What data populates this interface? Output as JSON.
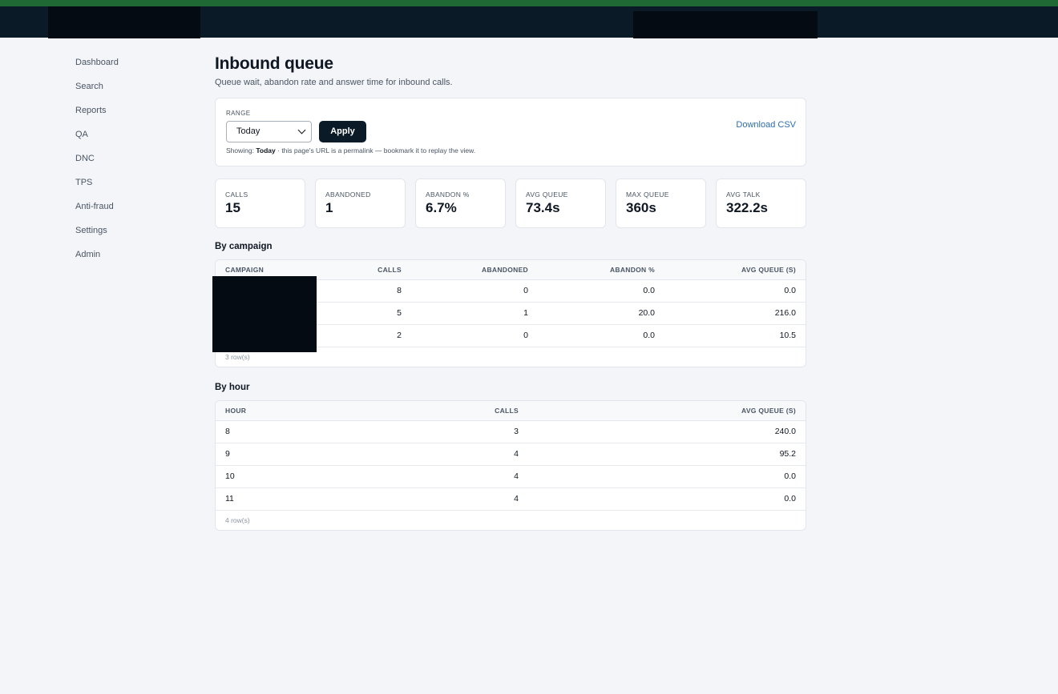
{
  "sidebar": {
    "items": [
      {
        "label": "Dashboard"
      },
      {
        "label": "Search"
      },
      {
        "label": "Reports"
      },
      {
        "label": "QA"
      },
      {
        "label": "DNC"
      },
      {
        "label": "TPS"
      },
      {
        "label": "Anti-fraud"
      },
      {
        "label": "Settings"
      },
      {
        "label": "Admin"
      }
    ]
  },
  "page": {
    "title": "Inbound queue",
    "subtitle": "Queue wait, abandon rate and answer time for inbound calls."
  },
  "filter": {
    "range_label": "RANGE",
    "range_selected": "Today",
    "apply_label": "Apply",
    "showing_prefix": "Showing:",
    "showing_value": "Today",
    "showing_suffix": "· this page's URL is a permalink — bookmark it to replay the view.",
    "download_label": "Download CSV"
  },
  "stats": [
    {
      "label": "CALLS",
      "value": "15"
    },
    {
      "label": "ABANDONED",
      "value": "1"
    },
    {
      "label": "ABANDON %",
      "value": "6.7%"
    },
    {
      "label": "AVG QUEUE",
      "value": "73.4s"
    },
    {
      "label": "MAX QUEUE",
      "value": "360s"
    },
    {
      "label": "AVG TALK",
      "value": "322.2s"
    }
  ],
  "by_campaign": {
    "title": "By campaign",
    "columns": [
      "CAMPAIGN",
      "CALLS",
      "ABANDONED",
      "ABANDON %",
      "AVG QUEUE (S)"
    ],
    "rows": [
      {
        "campaign": "",
        "calls": "8",
        "abandoned": "0",
        "abandon_pct": "0.0",
        "avg_queue": "0.0"
      },
      {
        "campaign": "",
        "calls": "5",
        "abandoned": "1",
        "abandon_pct": "20.0",
        "avg_queue": "216.0"
      },
      {
        "campaign": "",
        "calls": "2",
        "abandoned": "0",
        "abandon_pct": "0.0",
        "avg_queue": "10.5"
      }
    ],
    "row_count": "3 row(s)"
  },
  "by_hour": {
    "title": "By hour",
    "columns": [
      "HOUR",
      "CALLS",
      "AVG QUEUE (S)"
    ],
    "rows": [
      {
        "hour": "8",
        "calls": "3",
        "avg_queue": "240.0"
      },
      {
        "hour": "9",
        "calls": "4",
        "avg_queue": "95.2"
      },
      {
        "hour": "10",
        "calls": "4",
        "avg_queue": "0.0"
      },
      {
        "hour": "11",
        "calls": "4",
        "avg_queue": "0.0"
      }
    ],
    "row_count": "4 row(s)"
  },
  "colors": {
    "header_bg": "#0b1a27",
    "header_stripe": "#1f6a34",
    "link": "#2b6cb0",
    "page_bg": "#f3f5f9"
  }
}
